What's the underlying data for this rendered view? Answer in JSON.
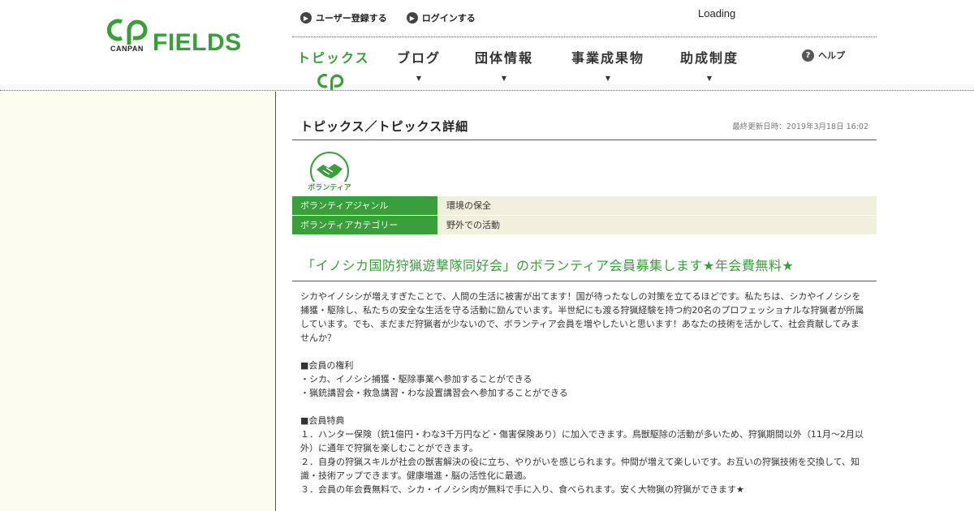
{
  "brand": {
    "canpan": "CANPAN",
    "fields": "FIELDS"
  },
  "toplinks": [
    {
      "label": "ユーザー登録する"
    },
    {
      "label": "ログインする"
    }
  ],
  "loading": "Loading",
  "nav": [
    {
      "label": "トピックス",
      "active": true
    },
    {
      "label": "ブログ"
    },
    {
      "label": "団体情報"
    },
    {
      "label": "事業成果物"
    },
    {
      "label": "助成制度"
    }
  ],
  "help": "ヘルプ",
  "breadcrumb": "トピックス／トピックス詳細",
  "updated": "最終更新日時：2019年3月18日 16:02",
  "volunteer_icon_label": "ボランティア",
  "info": [
    {
      "label": "ボランティアジャンル",
      "value": "環境の保全"
    },
    {
      "label": "ボランティアカテゴリー",
      "value": "野外での活動"
    }
  ],
  "article_title": "「イノシカ国防狩猟遊撃隊同好会」のボランティア会員募集します★年会費無料★",
  "body": {
    "intro_1": "シカやイノシシが増えすぎたことで、人間の生活に被害が出てます！国が待ったなしの対策を立てるほどです。私たちは、シカやイノシシを",
    "intro_2": "捕獲・駆除し、私たちの安全な生活を守る活動に励んでいます。半世紀にも渡る狩猟経験を持つ約20名のプロフェッショナルな狩猟者が所属",
    "intro_3": "しています。でも、まだまだ狩猟者が少ないので、ボランティア会員を増やしたいと思います！あなたの技術を活かして、社会貢献してみま",
    "intro_4": "せんか？",
    "rights_heading": "■会員の権利",
    "rights_1": "・シカ、イノシシ捕獲・駆除事業へ参加することができる",
    "rights_2": "・猟銃講習会・救急講習・わな設置講習会へ参加することができる",
    "perks_heading": "■会員特典",
    "perk_1a": "１．ハンター保険（銃1億円・わな3千万円など・傷害保険あり）に加入できます。鳥獣駆除の活動が多いため、狩猟期間以外（11月～2月以",
    "perk_1b": "外）に通年で狩猟を楽しむことができます。",
    "perk_2a": "２．自身の狩猟スキルが社会の獣害解決の役に立ち、やりがいを感じられます。仲間が増えて楽しいです。お互いの狩猟技術を交換して、知",
    "perk_2b": "識・技術アップできます。健康増進・脳の活性化に最適。",
    "perk_3": "３．会員の年会費無料で、シカ・イノシシ肉が無料で手に入り、食べられます。安く大物猟の狩猟ができます★"
  },
  "colors": {
    "accent": "#3a9e3a",
    "table_value_bg": "#f1f0dc",
    "sidebar_bg": "#fcfdf0"
  }
}
